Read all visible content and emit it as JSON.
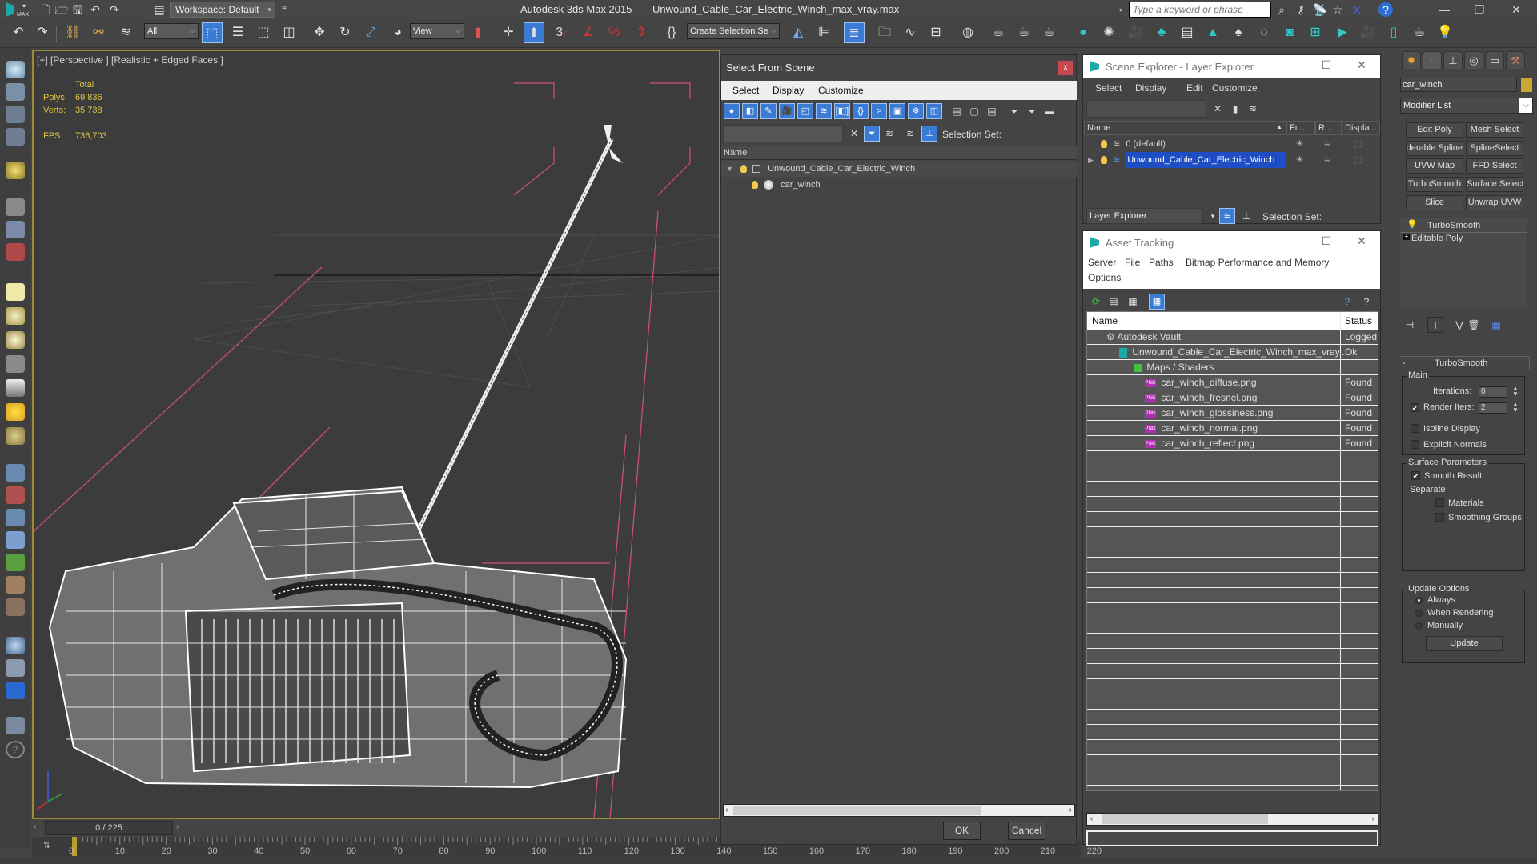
{
  "titlebar": {
    "app_title": "Autodesk 3ds Max  2015",
    "document_title": "Unwound_Cable_Car_Electric_Winch_max_vray.max",
    "workspace": "Workspace: Default",
    "search_placeholder": "Type a keyword or phrase",
    "logo_label": "MAX"
  },
  "toolbar": {
    "selection_filter": "All",
    "reference_coord": "View",
    "named_selection": "Create Selection Se",
    "snap_label": "3"
  },
  "viewport": {
    "label": "[+] [Perspective ] [Realistic + Edged Faces ]",
    "stats": {
      "total_label": "Total",
      "polys_label": "Polys:",
      "polys_value": "69 836",
      "verts_label": "Verts:",
      "verts_value": "35 738",
      "fps_label": "FPS:",
      "fps_value": "736,703"
    }
  },
  "timeslider": {
    "frame_counter": "0 / 225",
    "current_frame": 0,
    "total_frames": 225,
    "ticks": [
      "0",
      "10",
      "20",
      "30",
      "40",
      "50",
      "60",
      "70",
      "80",
      "90",
      "100",
      "110",
      "120",
      "130",
      "140",
      "150",
      "160",
      "170",
      "180",
      "190",
      "200",
      "210",
      "220"
    ]
  },
  "select_from_scene": {
    "title": "Select From Scene",
    "close_label": "x",
    "menu": [
      "Select",
      "Display",
      "Customize"
    ],
    "selection_set_label": "Selection Set:",
    "column_name": "Name",
    "tree": [
      {
        "name": "Unwound_Cable_Car_Electric_Winch",
        "level": 0,
        "expanded": true
      },
      {
        "name": "car_winch",
        "level": 1
      }
    ],
    "ok_label": "OK",
    "cancel_label": "Cancel"
  },
  "scene_explorer": {
    "title": "Scene Explorer - Layer Explorer",
    "menu": [
      "Select",
      "Display",
      "Edit",
      "Customize"
    ],
    "columns": [
      "Name",
      "Fr...",
      "R...",
      "Displa..."
    ],
    "layers": [
      {
        "name": "0 (default)",
        "selected": false
      },
      {
        "name": "Unwound_Cable_Car_Electric_Winch",
        "selected": true
      }
    ],
    "explorer_mode": "Layer Explorer",
    "selection_set_label": "Selection Set:"
  },
  "asset_tracking": {
    "title": "Asset Tracking",
    "menu": [
      "Server",
      "File",
      "Paths",
      "Bitmap Performance and Memory",
      "Options"
    ],
    "columns": [
      "Name",
      "Status"
    ],
    "rows": [
      {
        "name": "Autodesk Vault",
        "status": "Logged",
        "icon": "vault-icon",
        "level": 0
      },
      {
        "name": "Unwound_Cable_Car_Electric_Winch_max_vray....",
        "status": "Ok",
        "icon": "max-file-icon",
        "level": 1
      },
      {
        "name": "Maps / Shaders",
        "status": "",
        "icon": "maps-icon",
        "level": 2
      },
      {
        "name": "car_winch_diffuse.png",
        "status": "Found",
        "icon": "png-icon",
        "level": 3
      },
      {
        "name": "car_winch_fresnel.png",
        "status": "Found",
        "icon": "png-icon",
        "level": 3
      },
      {
        "name": "car_winch_glossiness.png",
        "status": "Found",
        "icon": "png-icon",
        "level": 3
      },
      {
        "name": "car_winch_normal.png",
        "status": "Found",
        "icon": "png-icon",
        "level": 3
      },
      {
        "name": "car_winch_reflect.png",
        "status": "Found",
        "icon": "png-icon",
        "level": 3
      }
    ]
  },
  "command_panel": {
    "object_name": "car_winch",
    "object_color": "#c8a832",
    "modifier_list": "Modifier List",
    "modifier_buttons": [
      "Edit Poly",
      "Mesh Select",
      "Renderable Spline",
      "SplineSelect",
      "UVW Map",
      "FFD Select",
      "TurboSmooth",
      "Surface Select",
      "Slice",
      "Unwrap UVW"
    ],
    "stack": [
      "TurboSmooth",
      "Editable Poly"
    ],
    "turbosmooth": {
      "title": "TurboSmooth",
      "collapse": "-",
      "main_label": "Main",
      "iterations_label": "Iterations:",
      "iterations_value": "0",
      "render_iters_label": "Render Iters:",
      "render_iters_value": "2",
      "render_iters_checked": true,
      "isoline_label": "Isoline Display",
      "isoline_checked": false,
      "explicit_normals_label": "Explicit Normals",
      "explicit_normals_checked": false,
      "surface_params_label": "Surface Parameters",
      "smooth_result_label": "Smooth Result",
      "smooth_result_checked": true,
      "separate_label": "Separate",
      "materials_label": "Materials",
      "smoothing_groups_label": "Smoothing Groups",
      "update_options_label": "Update Options",
      "always_label": "Always",
      "when_rendering_label": "When Rendering",
      "manually_label": "Manually",
      "update_mode": "Always",
      "update_button": "Update"
    }
  },
  "colors": {
    "accent_blue": "#3a7bd5",
    "viewport_border": "#a08a3a",
    "stats_yellow": "#e0c640",
    "close_red": "#c9474d",
    "png_magenta": "#b02fb0",
    "selection_blue": "#1f4ec4"
  }
}
